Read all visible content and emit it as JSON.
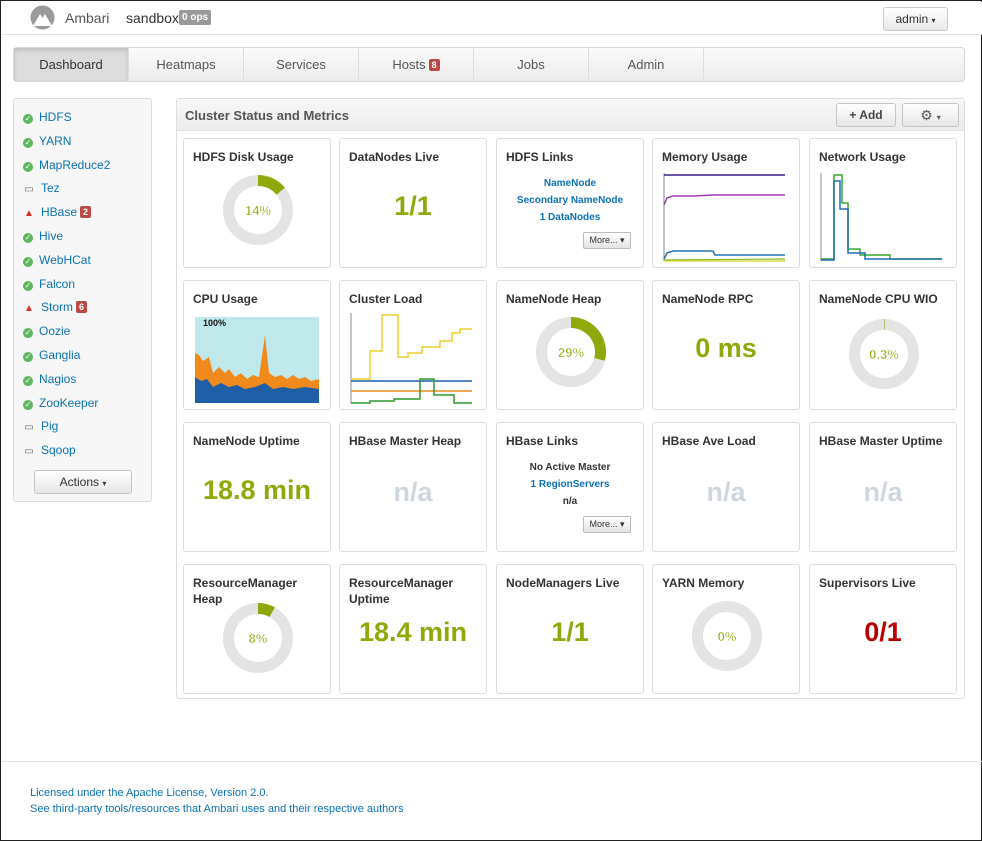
{
  "header": {
    "brand": "Ambari",
    "cluster_name": "sandbox",
    "ops_badge": "0 ops",
    "user_menu": "admin"
  },
  "nav": {
    "tabs": [
      {
        "label": "Dashboard",
        "active": true
      },
      {
        "label": "Heatmaps"
      },
      {
        "label": "Services"
      },
      {
        "label": "Hosts",
        "badge": "8"
      },
      {
        "label": "Jobs"
      },
      {
        "label": "Admin"
      }
    ]
  },
  "sidebar": {
    "services": [
      {
        "name": "HDFS",
        "status": "ok"
      },
      {
        "name": "YARN",
        "status": "ok"
      },
      {
        "name": "MapReduce2",
        "status": "ok"
      },
      {
        "name": "Tez",
        "status": "client"
      },
      {
        "name": "HBase",
        "status": "alert",
        "badge": "2"
      },
      {
        "name": "Hive",
        "status": "ok"
      },
      {
        "name": "WebHCat",
        "status": "ok"
      },
      {
        "name": "Falcon",
        "status": "ok"
      },
      {
        "name": "Storm",
        "status": "alert",
        "badge": "6"
      },
      {
        "name": "Oozie",
        "status": "ok"
      },
      {
        "name": "Ganglia",
        "status": "ok"
      },
      {
        "name": "Nagios",
        "status": "ok"
      },
      {
        "name": "ZooKeeper",
        "status": "ok"
      },
      {
        "name": "Pig",
        "status": "client"
      },
      {
        "name": "Sqoop",
        "status": "client"
      }
    ],
    "actions_label": "Actions"
  },
  "panel": {
    "title": "Cluster Status and Metrics",
    "add_label": "Add"
  },
  "widgets": {
    "hdfs_disk": {
      "title": "HDFS Disk Usage",
      "value": "14%",
      "fraction": 0.14
    },
    "datanodes_live": {
      "title": "DataNodes Live",
      "value": "1/1"
    },
    "hdfs_links": {
      "title": "HDFS Links",
      "links": [
        "NameNode",
        "Secondary NameNode",
        "1 DataNodes"
      ],
      "more": "More..."
    },
    "memory_usage": {
      "title": "Memory Usage"
    },
    "network_usage": {
      "title": "Network Usage"
    },
    "cpu_usage": {
      "title": "CPU Usage",
      "scale_label": "100%"
    },
    "cluster_load": {
      "title": "Cluster Load"
    },
    "namenode_heap": {
      "title": "NameNode Heap",
      "value": "29%",
      "fraction": 0.29
    },
    "namenode_rpc": {
      "title": "NameNode RPC",
      "value": "0 ms"
    },
    "namenode_cpu_wio": {
      "title": "NameNode CPU WIO",
      "value": "0.3%",
      "fraction": 0.003
    },
    "namenode_uptime": {
      "title": "NameNode Uptime",
      "value": "18.8 min"
    },
    "hbase_master_heap": {
      "title": "HBase Master Heap",
      "value": "n/a"
    },
    "hbase_links": {
      "title": "HBase Links",
      "line1": "No Active Master",
      "line2": "1 RegionServers",
      "line3": "n/a",
      "more": "More..."
    },
    "hbase_ave_load": {
      "title": "HBase Ave Load",
      "value": "n/a"
    },
    "hbase_master_uptime": {
      "title": "HBase Master Uptime",
      "value": "n/a"
    },
    "rm_heap": {
      "title": "ResourceManager Heap",
      "value": "8%",
      "fraction": 0.08
    },
    "rm_uptime": {
      "title": "ResourceManager Uptime",
      "value": "18.4 min"
    },
    "nodemanagers_live": {
      "title": "NodeManagers Live",
      "value": "1/1"
    },
    "yarn_memory": {
      "title": "YARN Memory",
      "value": "0%",
      "fraction": 0.0
    },
    "supervisors_live": {
      "title": "Supervisors Live",
      "value": "0/1"
    }
  },
  "footer": {
    "license": "Licensed under the Apache License, Version 2.0.",
    "third_party": "See third-party tools/resources that Ambari uses and their respective authors"
  },
  "colors": {
    "accent": "#8ea909",
    "link": "#0a72b5",
    "alert": "#b00000",
    "muted": "#cfd6dd"
  }
}
